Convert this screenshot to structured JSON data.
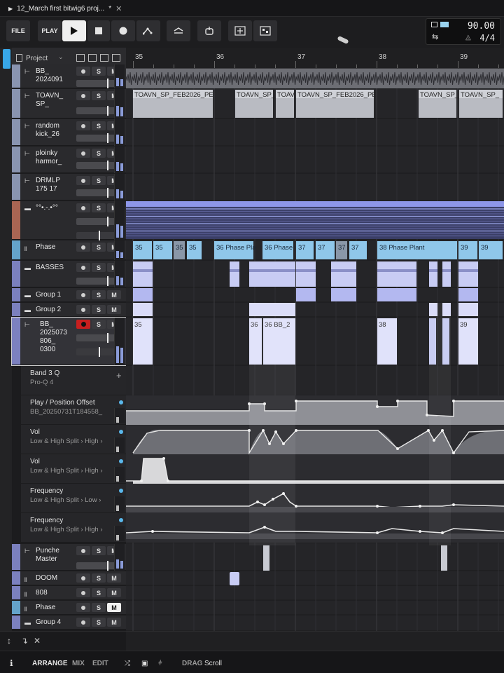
{
  "window": {
    "tab_title": "12_March first bitwig6 proj...",
    "tab_modified": "*",
    "close_glyph": "✕"
  },
  "transport": {
    "file_label": "FILE",
    "play_label": "PLAY",
    "tempo": "90.00",
    "time_signature": "4/4"
  },
  "panel": {
    "title": "Project"
  },
  "ruler": {
    "bars": [
      "35",
      "36",
      "37",
      "38",
      "39"
    ]
  },
  "tracks": [
    {
      "id": "t1",
      "name": "BB_",
      "sub": "2024091",
      "buttons": [
        "S",
        "M"
      ],
      "color": "#9aa7c8"
    },
    {
      "id": "t2",
      "name": "TOAVN_",
      "sub": "SP_",
      "buttons": [
        "S",
        "M"
      ],
      "color": "#9aa7c8"
    },
    {
      "id": "t3",
      "name": "random",
      "sub": "kick_26",
      "buttons": [
        "S",
        "M"
      ],
      "color": "#9aa7c8"
    },
    {
      "id": "t4",
      "name": "ploinky",
      "sub": "harmor_",
      "buttons": [
        "S",
        "M"
      ],
      "color": "#9aa7c8"
    },
    {
      "id": "t5",
      "name": "DRMLP",
      "sub": "175 17",
      "buttons": [
        "S",
        "M"
      ],
      "color": "#9aa7c8"
    },
    {
      "id": "t6",
      "name": "°°•.-.•°°",
      "sub": "",
      "buttons": [
        "S",
        "M"
      ],
      "color": "#c0705a"
    },
    {
      "id": "t7",
      "name": "Phase",
      "sub": "",
      "buttons": [
        "S",
        "M"
      ],
      "color": "#6fb8e6"
    },
    {
      "id": "t8",
      "name": "BASSES",
      "sub": "",
      "buttons": [
        "S",
        "M"
      ],
      "color": "#8a8fd8"
    },
    {
      "id": "t9",
      "name": "Group 1",
      "sub": "",
      "buttons": [
        "S",
        "M"
      ],
      "color": "#8a8fd8"
    },
    {
      "id": "t10",
      "name": "Group 2",
      "sub": "",
      "buttons": [
        "S",
        "M"
      ],
      "color": "#8a8fd8"
    },
    {
      "id": "t11",
      "name": "BB_",
      "sub": "2025073",
      "sub2": "806_",
      "sub3": "0300",
      "buttons": [
        "S",
        "M"
      ],
      "color": "#8a8fd8"
    },
    {
      "id": "t12",
      "name": "Punche",
      "sub": "Master",
      "buttons": [
        "S",
        "M"
      ],
      "color": "#8a8fd8"
    },
    {
      "id": "t13",
      "name": "DOOM",
      "sub": "",
      "buttons": [
        "S",
        "M"
      ],
      "color": "#8a8fd8"
    },
    {
      "id": "t14",
      "name": "808",
      "sub": "",
      "buttons": [
        "S",
        "M"
      ],
      "color": "#8a8fd8"
    },
    {
      "id": "t15",
      "name": "Phase",
      "sub": "",
      "buttons": [
        "S",
        "M"
      ],
      "color": "#6fb8e6"
    },
    {
      "id": "t16",
      "name": "Group 4",
      "sub": "",
      "buttons": [
        "S",
        "M"
      ],
      "color": "#8a8fd8"
    }
  ],
  "automation": [
    {
      "label": "Band 3 Q",
      "device": "Pro-Q 4"
    },
    {
      "label": "Play / Position Offset",
      "device": "BB_20250731T184558_"
    },
    {
      "label": "Vol",
      "device": "Low & High Split › High ›"
    },
    {
      "label": "Vol",
      "device": "Low & High Split › High ›"
    },
    {
      "label": "Frequency",
      "device": "Low & High Split › Low ›"
    },
    {
      "label": "Frequency",
      "device": "Low & High Split › High ›"
    }
  ],
  "clips": {
    "toavn": [
      "TOAVN_SP_FEB2026_PE",
      "TOAVN_SP_",
      "TOAV",
      "TOAVN_SP_FEB2026_PE",
      "TOAVN_SP_",
      "TOAVN_SP_"
    ],
    "phase": [
      "35",
      "35",
      "35",
      "35",
      "36 Phase Pla",
      "36 Phase",
      "37",
      "37",
      "37",
      "37",
      "38 Phase Plant",
      "39",
      "39"
    ],
    "bb": [
      "35",
      "36",
      "36 BB_2",
      "38",
      "39"
    ]
  },
  "footer": {
    "arrange": "ARRANGE",
    "mix": "MIX",
    "edit": "EDIT",
    "drag_label": "DRAG",
    "drag_value": "Scroll"
  },
  "icons": [
    "play-icon",
    "stop-icon",
    "record-icon",
    "automation-icon",
    "metronome-icon",
    "cue-icon",
    "add-icon",
    "grid-icon",
    "info-icon",
    "mixer-icon"
  ]
}
